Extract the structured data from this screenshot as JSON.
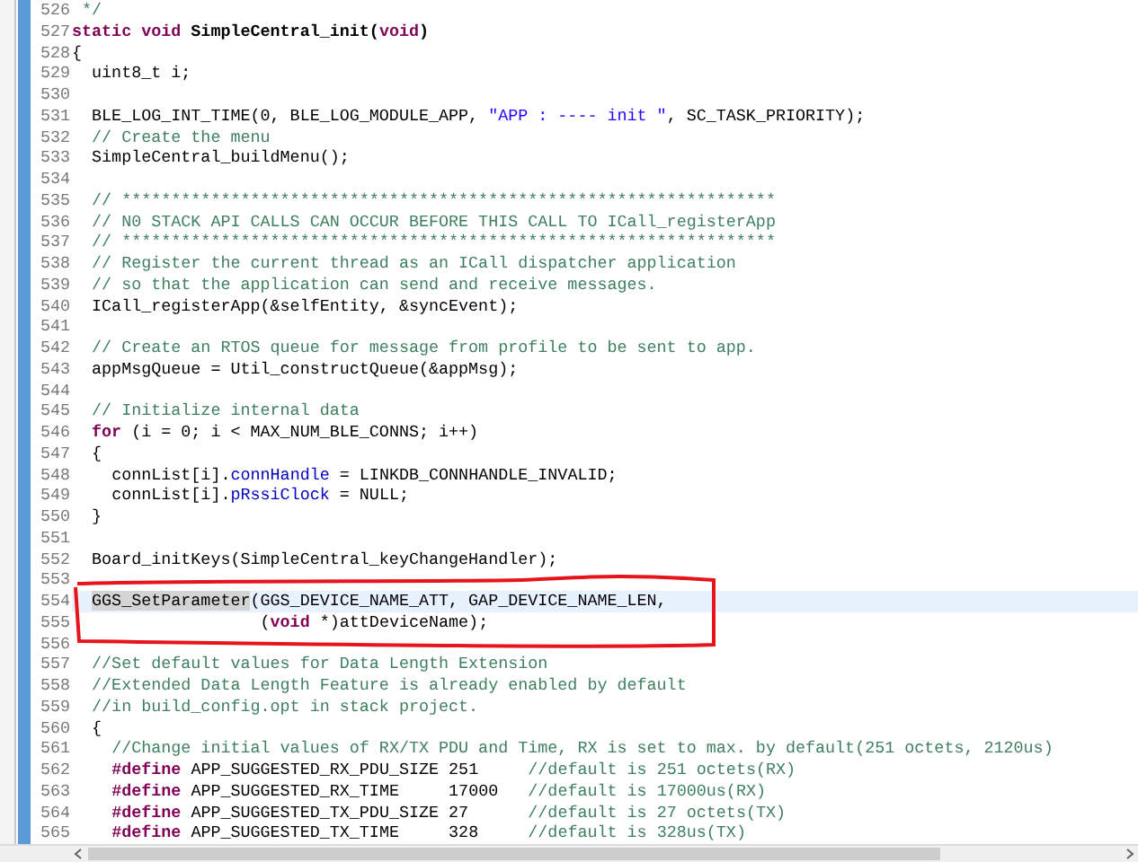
{
  "editor": {
    "lines": [
      {
        "number": "526",
        "current": false,
        "tokens": [
          {
            "kind": "comment",
            "text": " */"
          }
        ]
      },
      {
        "number": "527",
        "current": false,
        "tokens": [
          {
            "kind": "keyword",
            "text": "static void"
          },
          {
            "kind": "bold",
            "text": " SimpleCentral_init("
          },
          {
            "kind": "keyword",
            "text": "void"
          },
          {
            "kind": "bold",
            "text": ")"
          }
        ]
      },
      {
        "number": "528",
        "current": false,
        "tokens": [
          {
            "kind": "plain",
            "text": "{"
          }
        ]
      },
      {
        "number": "529",
        "current": false,
        "tokens": [
          {
            "kind": "plain",
            "text": "  uint8_t i;"
          }
        ]
      },
      {
        "number": "530",
        "current": false
      },
      {
        "number": "531",
        "current": false,
        "tokens": [
          {
            "kind": "plain",
            "text": "  BLE_LOG_INT_TIME(0, BLE_LOG_MODULE_APP, "
          },
          {
            "kind": "string",
            "text": "\"APP : ---- init \""
          },
          {
            "kind": "plain",
            "text": ", SC_TASK_PRIORITY);"
          }
        ]
      },
      {
        "number": "532",
        "current": false,
        "tokens": [
          {
            "kind": "comment",
            "text": "  // Create the menu"
          }
        ]
      },
      {
        "number": "533",
        "current": false,
        "tokens": [
          {
            "kind": "plain",
            "text": "  SimpleCentral_buildMenu();"
          }
        ]
      },
      {
        "number": "534",
        "current": false
      },
      {
        "number": "535",
        "current": false,
        "tokens": [
          {
            "kind": "comment",
            "text": "  // ******************************************************************"
          }
        ]
      },
      {
        "number": "536",
        "current": false,
        "tokens": [
          {
            "kind": "comment",
            "text": "  // N0 STACK API CALLS CAN OCCUR BEFORE THIS CALL TO ICall_registerApp"
          }
        ]
      },
      {
        "number": "537",
        "current": false,
        "tokens": [
          {
            "kind": "comment",
            "text": "  // ******************************************************************"
          }
        ]
      },
      {
        "number": "538",
        "current": false,
        "tokens": [
          {
            "kind": "comment",
            "text": "  // Register the current thread as an ICall dispatcher application"
          }
        ]
      },
      {
        "number": "539",
        "current": false,
        "tokens": [
          {
            "kind": "comment",
            "text": "  // so that the application can send and receive messages."
          }
        ]
      },
      {
        "number": "540",
        "current": false,
        "tokens": [
          {
            "kind": "plain",
            "text": "  ICall_registerApp(&selfEntity, &syncEvent);"
          }
        ]
      },
      {
        "number": "541",
        "current": false
      },
      {
        "number": "542",
        "current": false,
        "tokens": [
          {
            "kind": "comment",
            "text": "  // Create an RTOS queue for message from profile to be sent to app."
          }
        ]
      },
      {
        "number": "543",
        "current": false,
        "tokens": [
          {
            "kind": "plain",
            "text": "  appMsgQueue = Util_constructQueue(&appMsg);"
          }
        ]
      },
      {
        "number": "544",
        "current": false
      },
      {
        "number": "545",
        "current": false,
        "tokens": [
          {
            "kind": "comment",
            "text": "  // Initialize internal data"
          }
        ]
      },
      {
        "number": "546",
        "current": false,
        "tokens": [
          {
            "kind": "keyword",
            "text": "  for"
          },
          {
            "kind": "plain",
            "text": " (i = 0; i < MAX_NUM_BLE_CONNS; i++)"
          }
        ]
      },
      {
        "number": "547",
        "current": false,
        "tokens": [
          {
            "kind": "plain",
            "text": "  {"
          }
        ]
      },
      {
        "number": "548",
        "current": false,
        "tokens": [
          {
            "kind": "plain",
            "text": "    connList[i]."
          },
          {
            "kind": "field",
            "text": "connHandle"
          },
          {
            "kind": "plain",
            "text": " = LINKDB_CONNHANDLE_INVALID;"
          }
        ]
      },
      {
        "number": "549",
        "current": false,
        "tokens": [
          {
            "kind": "plain",
            "text": "    connList[i]."
          },
          {
            "kind": "field",
            "text": "pRssiClock"
          },
          {
            "kind": "plain",
            "text": " = NULL;"
          }
        ]
      },
      {
        "number": "550",
        "current": false,
        "tokens": [
          {
            "kind": "plain",
            "text": "  }"
          }
        ]
      },
      {
        "number": "551",
        "current": false
      },
      {
        "number": "552",
        "current": false,
        "tokens": [
          {
            "kind": "plain",
            "text": "  Board_initKeys(SimpleCentral_keyChangeHandler);"
          }
        ]
      },
      {
        "number": "553",
        "current": false
      },
      {
        "number": "554",
        "current": true,
        "tokens": [
          {
            "kind": "occurrence",
            "text": "  GGS_SetParameter"
          },
          {
            "kind": "plain",
            "text": "(GGS_DEVICE_NAME_ATT, GAP_DEVICE_NAME_LEN,"
          }
        ]
      },
      {
        "number": "555",
        "current": false,
        "tokens": [
          {
            "kind": "plain",
            "text": "                   ("
          },
          {
            "kind": "keyword",
            "text": "void"
          },
          {
            "kind": "plain",
            "text": " *)attDeviceName);"
          }
        ]
      },
      {
        "number": "556",
        "current": false
      },
      {
        "number": "557",
        "current": false,
        "tokens": [
          {
            "kind": "comment",
            "text": "  //Set default values for Data Length Extension"
          }
        ]
      },
      {
        "number": "558",
        "current": false,
        "tokens": [
          {
            "kind": "comment",
            "text": "  //Extended Data Length Feature is already enabled by default"
          }
        ]
      },
      {
        "number": "559",
        "current": false,
        "tokens": [
          {
            "kind": "comment",
            "text": "  //in build_config.opt in stack project."
          }
        ]
      },
      {
        "number": "560",
        "current": false,
        "tokens": [
          {
            "kind": "plain",
            "text": "  {"
          }
        ]
      },
      {
        "number": "561",
        "current": false,
        "tokens": [
          {
            "kind": "comment",
            "text": "    //Change initial values of RX/TX PDU and Time, RX is set to max. by default(251 octets, 2120us)"
          }
        ]
      },
      {
        "number": "562",
        "current": false,
        "tokens": [
          {
            "kind": "keyword",
            "text": "    #define"
          },
          {
            "kind": "plain",
            "text": " APP_SUGGESTED_RX_PDU_SIZE 251     "
          },
          {
            "kind": "comment",
            "text": "//default is 251 octets(RX)"
          }
        ]
      },
      {
        "number": "563",
        "current": false,
        "tokens": [
          {
            "kind": "keyword",
            "text": "    #define"
          },
          {
            "kind": "plain",
            "text": " APP_SUGGESTED_RX_TIME     17000   "
          },
          {
            "kind": "comment",
            "text": "//default is 17000us(RX)"
          }
        ]
      },
      {
        "number": "564",
        "current": false,
        "tokens": [
          {
            "kind": "keyword",
            "text": "    #define"
          },
          {
            "kind": "plain",
            "text": " APP_SUGGESTED_TX_PDU_SIZE 27      "
          },
          {
            "kind": "comment",
            "text": "//default is 27 octets(TX)"
          }
        ]
      },
      {
        "number": "565",
        "current": false,
        "tokens": [
          {
            "kind": "keyword",
            "text": "    #define"
          },
          {
            "kind": "plain",
            "text": " APP_SUGGESTED_TX_TIME     328     "
          },
          {
            "kind": "comment",
            "text": "//default is 328us(TX)"
          }
        ]
      }
    ]
  }
}
